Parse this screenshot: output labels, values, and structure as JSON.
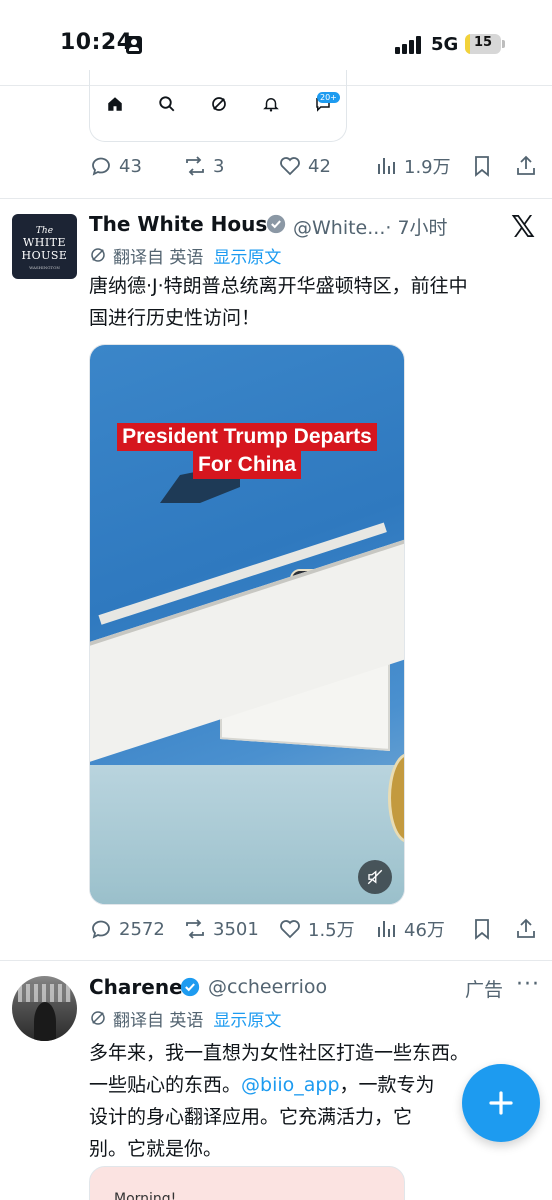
{
  "status_bar": {
    "time": "10:24",
    "network": "5G",
    "battery": "15",
    "battery_fraction": 0.15
  },
  "prev_tweet": {
    "embed_icons": [
      "home-icon",
      "search-icon",
      "grok-icon",
      "bell-icon",
      "message-icon"
    ],
    "embed_badge": "20+",
    "stats": {
      "replies": "43",
      "reposts": "3",
      "likes": "42",
      "views": "1.9万"
    }
  },
  "tweet1": {
    "name": "The White House",
    "handle": "@White...",
    "time": "· 7小时",
    "avatar": {
      "line1": "The",
      "line2": "WHITE",
      "line3": "HOUSE",
      "line4": "WASHINGTON"
    },
    "translate_label": "翻译自 英语",
    "show_original": "显示原文",
    "text_line1": "唐纳德·J·特朗普总统离开华盛顿特区，前往中",
    "text_line2": "国进行历史性访问！",
    "media_caption_line1": "President Trump Departs",
    "media_caption_line2": "For China",
    "stats": {
      "replies": "2572",
      "reposts": "3501",
      "likes": "1.5万",
      "views": "46万"
    }
  },
  "tweet2": {
    "name": "Charene",
    "handle": "@ccheerrioo",
    "ad_label": "广告",
    "more": "···",
    "translate_label": "翻译自 英语",
    "show_original": "显示原文",
    "text_line1": "多年来，我一直想为女性社区打造一些东西。",
    "text_line2a": "一些贴心的东西。",
    "text_line2_link": "@biio_app",
    "text_line2b": "，一款专为",
    "text_line3": "设计的身心翻译应用。它充满活力，它",
    "text_line4": "别。它就是你。",
    "card_text": "Morning!"
  },
  "colors": {
    "accent": "#1d9bf0",
    "secondary_text": "#536471",
    "caption_red": "#d6161e"
  }
}
